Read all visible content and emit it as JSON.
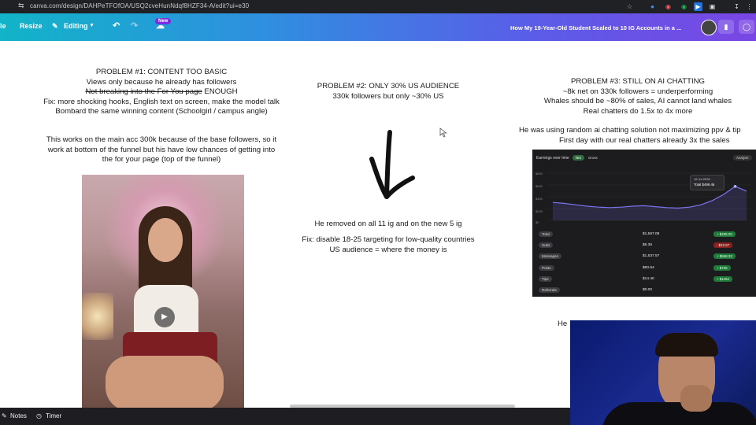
{
  "browser": {
    "url": "canva.com/design/DAHPeTFOfOA/USQ2cveHunNdqf8HZF34-A/edit?ui=e30"
  },
  "toolbar": {
    "resize_label": "Resize",
    "editing_label": "Editing",
    "new_badge": "New",
    "doc_title": "How My 19-Year-Old Student Scaled to 10 IG Accounts in a ..."
  },
  "problem1": {
    "title": "PROBLEM #1: CONTENT TOO BASIC",
    "line1": "Views only because he already has followers",
    "line2_strike": "Not breaking into the For You page",
    "line2_rest": " ENOUGH",
    "line3": "Fix: more shocking hooks, English text on screen, make the model talk",
    "line4": "Bombard the same winning content (Schoolgirl / campus angle)",
    "note1": "This works on the main acc 300k because of the base followers, so it",
    "note2": "work at bottom of the funnel but his have low chances of getting into",
    "note3": "the for your page (top of the funnel)"
  },
  "problem2": {
    "title": "PROBLEM #2: ONLY 30% US AUDIENCE",
    "line1": "330k followers but only ~30% US",
    "removed": "He removed on all 11 ig and on the new  5 ig",
    "fix1": "Fix: disable 18-25 targeting for low-quality countries",
    "fix2": "US audience = where the money is"
  },
  "problem3": {
    "title": "PROBLEM #3: STILL ON AI CHATTING",
    "line1": "~8k net on 330k followers = underperforming",
    "line2": "Whales should be ~80% of sales, AI cannot land whales",
    "line3": "Real chatters do 1.5x to 4x more",
    "line4": "He was using random ai chatting solution not maximizing ppv & tip",
    "line5": "First day with our real chatters already 3x the sales",
    "partial": "He"
  },
  "dashboard": {
    "title": "Earnings over time",
    "toggle_net": "Net",
    "toggle_gross": "Gross",
    "analyze": "Analyze",
    "tooltip_date": "16 Jul 2026",
    "tooltip_total": "Total  $499.46",
    "yticks": [
      "$800",
      "$600",
      "$400",
      "$200",
      "$0"
    ],
    "rows": [
      {
        "label": "Total",
        "value": "$1,567.08",
        "pct": "+ $435.20",
        "color": "#1f7a3a"
      },
      {
        "label": "Subs",
        "value": "$6.36",
        "pct": "- $22.57",
        "color": "#8a1f1f"
      },
      {
        "label": "Messages",
        "value": "$1,537.57",
        "pct": "+ $558.33",
        "color": "#1f7a3a"
      },
      {
        "label": "Posts",
        "value": "$60.64",
        "pct": "+ $735",
        "color": "#1f7a3a"
      },
      {
        "label": "Tips",
        "value": "$14.40",
        "pct": "+ $1454",
        "color": "#1f7a3a"
      },
      {
        "label": "Referrals",
        "value": "$0.00",
        "pct": "",
        "color": "#1c1c1f"
      }
    ],
    "series_line": [
      0.38,
      0.36,
      0.33,
      0.3,
      0.28,
      0.27,
      0.28,
      0.3,
      0.31,
      0.29,
      0.27,
      0.26,
      0.28,
      0.33,
      0.42,
      0.55,
      0.72,
      0.62
    ]
  },
  "footer": {
    "notes": "Notes",
    "timer": "Timer"
  }
}
